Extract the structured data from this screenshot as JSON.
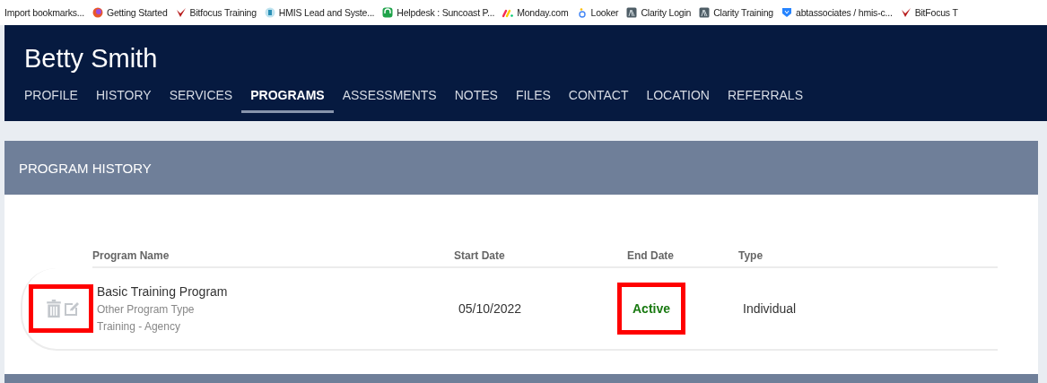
{
  "bookmarks": [
    {
      "label": "Import bookmarks..."
    },
    {
      "label": "Getting Started"
    },
    {
      "label": "Bitfocus Training"
    },
    {
      "label": "HMIS Lead and Syste..."
    },
    {
      "label": "Helpdesk : Suncoast P..."
    },
    {
      "label": "Monday.com"
    },
    {
      "label": "Looker"
    },
    {
      "label": "Clarity Login"
    },
    {
      "label": "Clarity Training"
    },
    {
      "label": "abtassociates / hmis-c..."
    },
    {
      "label": "BitFocus T"
    }
  ],
  "client": {
    "name": "Betty Smith"
  },
  "tabs": [
    {
      "label": "PROFILE",
      "selected": false
    },
    {
      "label": "HISTORY",
      "selected": false
    },
    {
      "label": "SERVICES",
      "selected": false
    },
    {
      "label": "PROGRAMS",
      "selected": true
    },
    {
      "label": "ASSESSMENTS",
      "selected": false
    },
    {
      "label": "NOTES",
      "selected": false
    },
    {
      "label": "FILES",
      "selected": false
    },
    {
      "label": "CONTACT",
      "selected": false
    },
    {
      "label": "LOCATION",
      "selected": false
    },
    {
      "label": "REFERRALS",
      "selected": false
    }
  ],
  "section": {
    "title": "PROGRAM HISTORY"
  },
  "table": {
    "columns": [
      "Program Name",
      "Start Date",
      "End Date",
      "Type"
    ],
    "rows": [
      {
        "program_name": "Basic Training Program",
        "program_type": "Other Program Type",
        "agency": "Training - Agency",
        "start_date": "05/10/2022",
        "end_date": "Active",
        "type": "Individual",
        "actions_highlighted": true,
        "end_date_highlighted": true
      }
    ]
  }
}
